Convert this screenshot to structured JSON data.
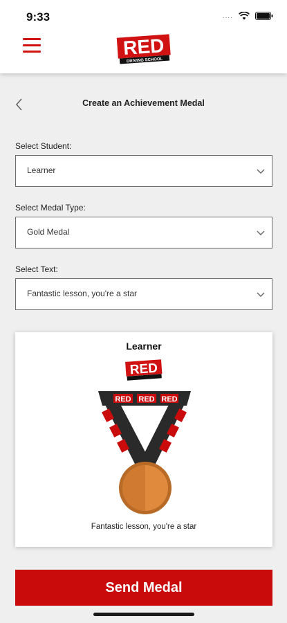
{
  "status_bar": {
    "time": "9:33",
    "signal": "....",
    "wifi_icon": "wifi-icon",
    "battery_icon": "battery-icon"
  },
  "header": {
    "menu_icon": "hamburger-menu-icon",
    "logo_text": "RED",
    "logo_subtext": "DRIVING SCHOOL"
  },
  "page": {
    "title": "Create an Achievement Medal",
    "back_icon": "chevron-left-icon"
  },
  "form": {
    "student": {
      "label": "Select Student:",
      "value": "Learner"
    },
    "medal_type": {
      "label": "Select Medal Type:",
      "value": "Gold Medal"
    },
    "text": {
      "label": "Select Text:",
      "value": "Fantastic lesson, you're a star"
    }
  },
  "preview": {
    "name": "Learner",
    "logo_text": "RED",
    "ribbon_text": "RED",
    "message": "Fantastic lesson, you're a star"
  },
  "actions": {
    "send_label": "Send Medal"
  },
  "colors": {
    "brand_red": "#c90b0b",
    "medal_bronze": "#d9823b",
    "ribbon": "#2a2a2a"
  }
}
